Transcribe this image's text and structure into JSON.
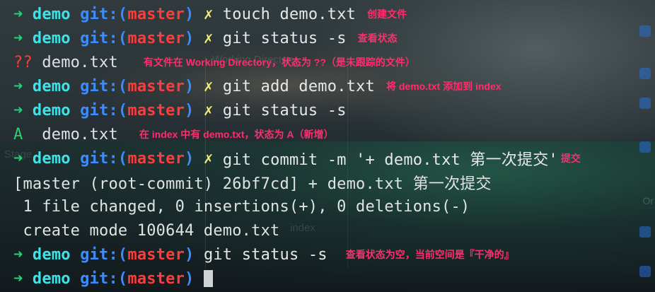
{
  "prompt": {
    "arrow": "➜",
    "dir": "demo",
    "git_open": "git:(",
    "branch": "master",
    "git_close": ")",
    "dirty_mark": "✗"
  },
  "lines": {
    "l1": {
      "cmd": "touch demo.txt",
      "note": "创建文件"
    },
    "l2": {
      "cmd": "git status -s",
      "note": "查看状态"
    },
    "l3": {
      "code": "??",
      "file": "demo.txt",
      "note": "有文件在 Working Directory，状态为 ??（是未跟踪的文件）"
    },
    "l4": {
      "cmd": "git add demo.txt",
      "note": "将 demo.txt 添加到 index"
    },
    "l5": {
      "cmd": "git status -s"
    },
    "l6": {
      "code": "A",
      "file": "demo.txt",
      "note": "在 index 中有 demo.txt，状态为 A（新增）"
    },
    "l7": {
      "cmd": "git commit -m '+ demo.txt 第一次提交'",
      "note": "提交"
    },
    "l8": {
      "text": "[master (root-commit) 26bf7cd] + demo.txt 第一次提交"
    },
    "l9": {
      "text": " 1 file changed, 0 insertions(+), 0 deletions(-)"
    },
    "l10": {
      "text": " create mode 100644 demo.txt"
    },
    "l11": {
      "cmd": "git status -s",
      "note": "查看状态为空，当前空间是『干净的』"
    }
  },
  "background": {
    "ghost_title": "Working Directory",
    "ghost_index": "index",
    "ghost_stage": "Stage",
    "side_label": "Or"
  }
}
